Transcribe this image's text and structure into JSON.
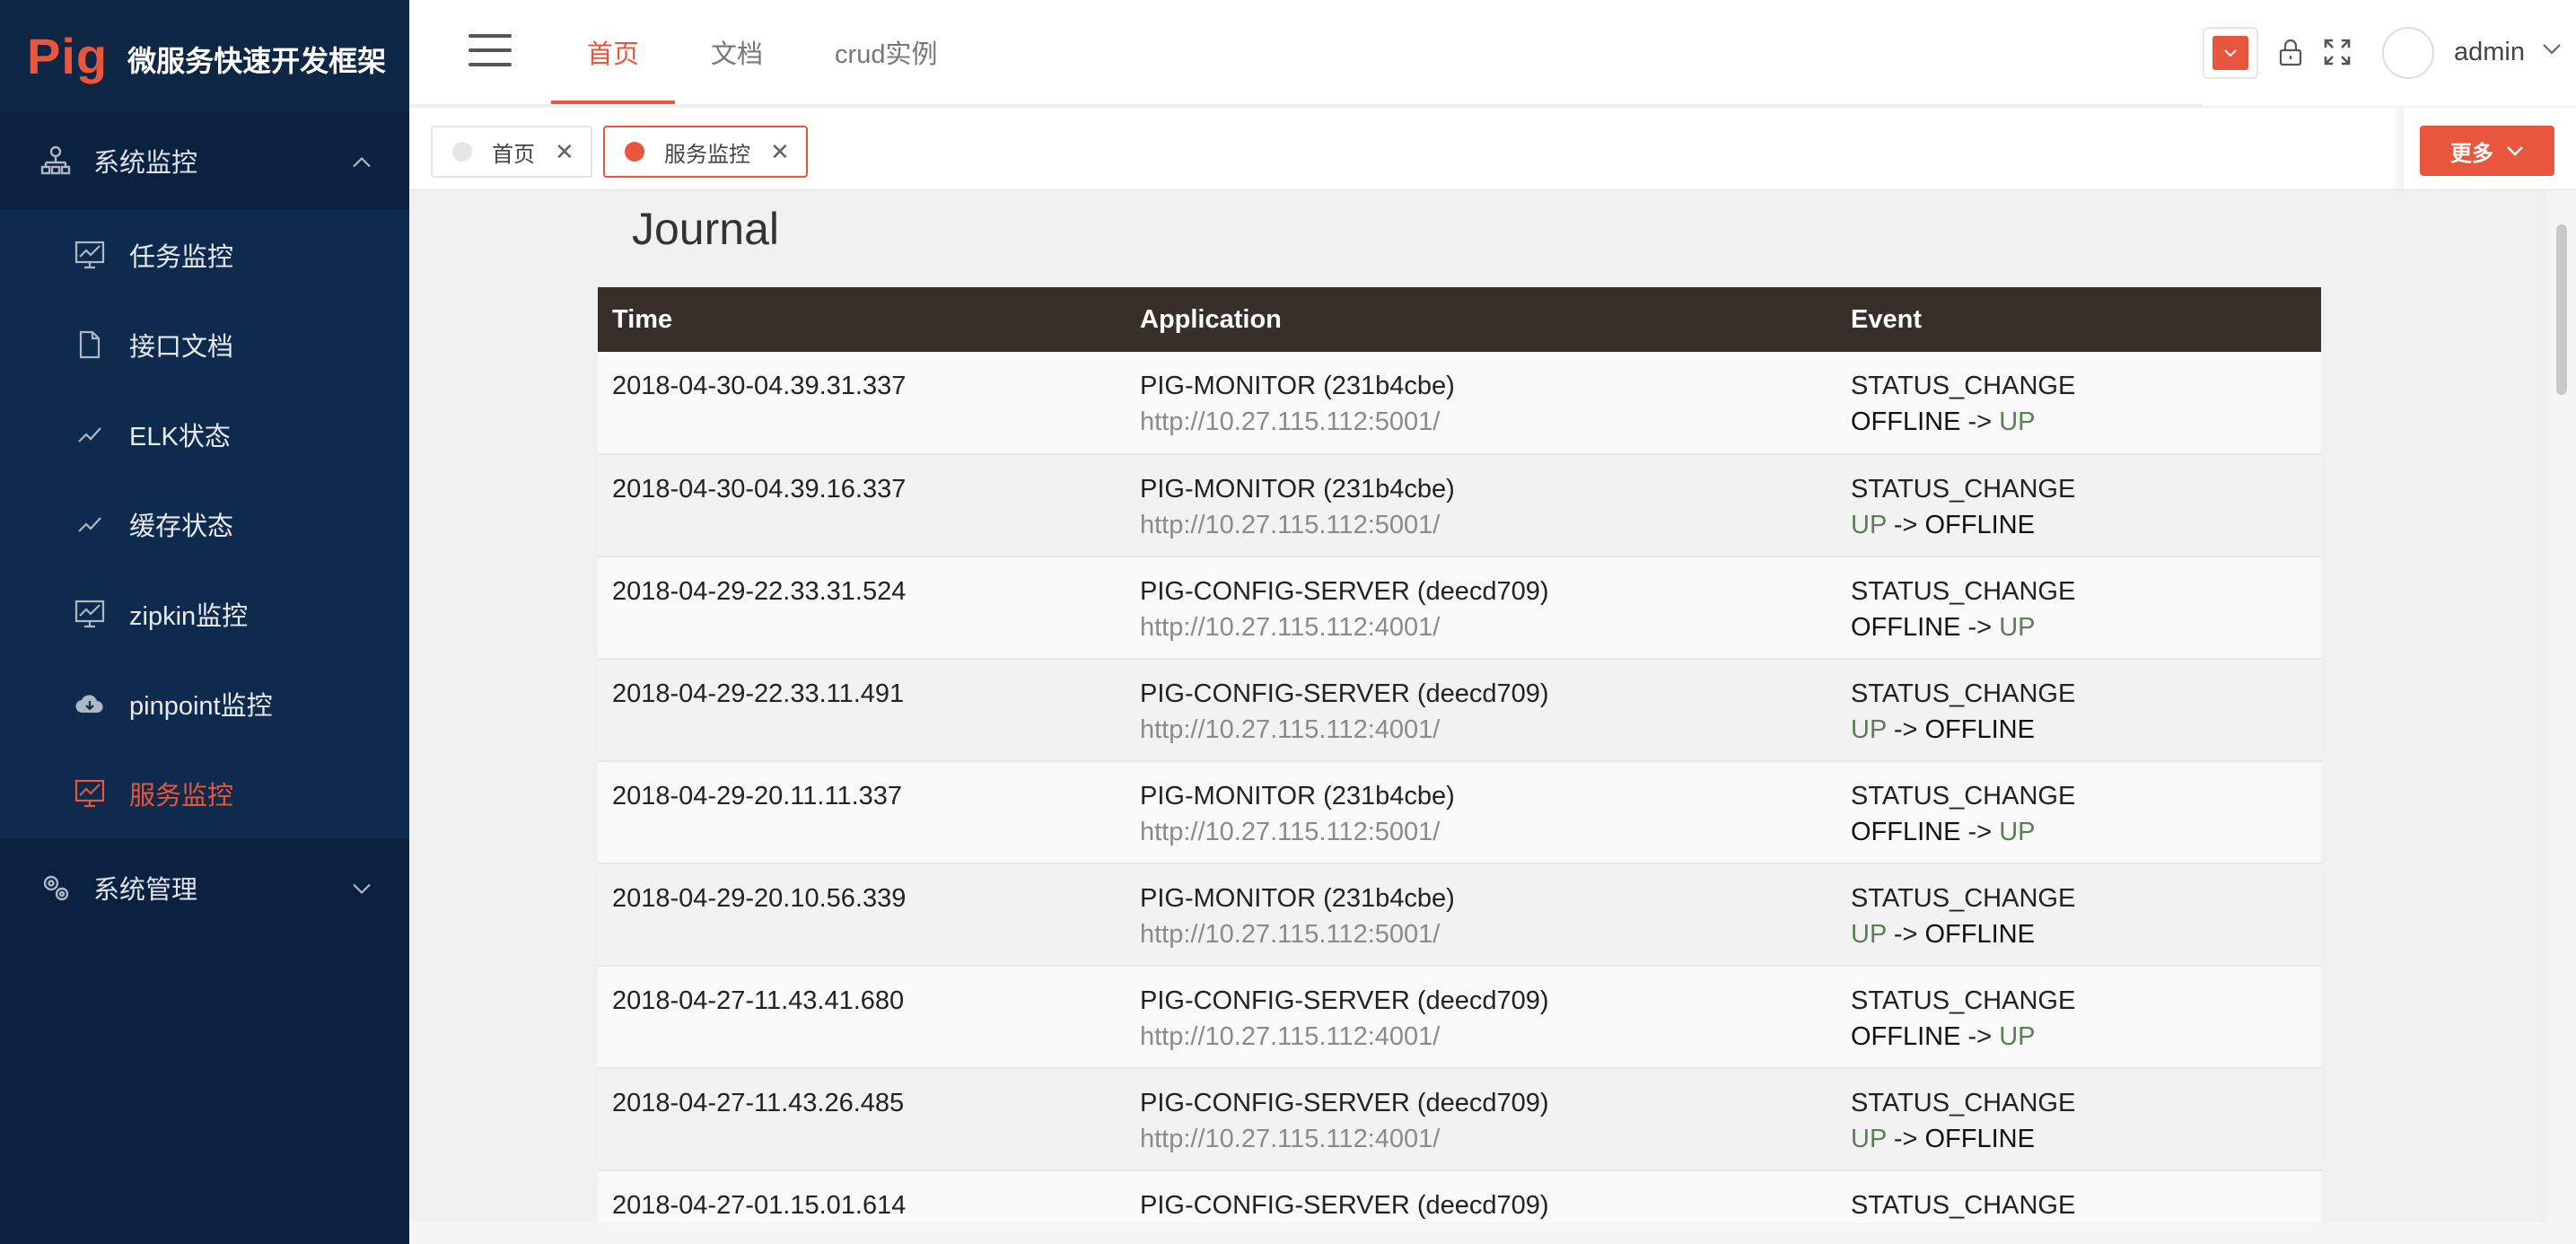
{
  "brand": {
    "mark": "Pig",
    "title": "微服务快速开发框架"
  },
  "sidebar": {
    "groups": [
      {
        "label": "系统监控",
        "expanded": true
      },
      {
        "label": "系统管理",
        "expanded": false
      }
    ],
    "items": [
      {
        "label": "任务监控",
        "icon": "monitor-chart-icon"
      },
      {
        "label": "接口文档",
        "icon": "document-icon"
      },
      {
        "label": "ELK状态",
        "icon": "trend-line-icon"
      },
      {
        "label": "缓存状态",
        "icon": "trend-line-icon"
      },
      {
        "label": "zipkin监控",
        "icon": "monitor-chart-icon"
      },
      {
        "label": "pinpoint监控",
        "icon": "cloud-icon"
      },
      {
        "label": "服务监控",
        "icon": "monitor-chart-icon",
        "active": true
      }
    ]
  },
  "header": {
    "nav": [
      {
        "label": "首页",
        "active": true
      },
      {
        "label": "文档"
      },
      {
        "label": "crud实例"
      }
    ],
    "theme_color": "#e8563e",
    "user": "admin"
  },
  "tabs": [
    {
      "label": "首页",
      "active": false
    },
    {
      "label": "服务监控",
      "active": true
    }
  ],
  "more_label": "更多",
  "journal": {
    "title": "Journal",
    "columns": [
      "Time",
      "Application",
      "Event"
    ],
    "rows": [
      {
        "time": "2018-04-30-04.39.31.337",
        "app": "PIG-MONITOR (231b4cbe)",
        "url": "http://10.27.115.112:5001/",
        "event": "STATUS_CHANGE",
        "from": "OFFLINE",
        "to": "UP"
      },
      {
        "time": "2018-04-30-04.39.16.337",
        "app": "PIG-MONITOR (231b4cbe)",
        "url": "http://10.27.115.112:5001/",
        "event": "STATUS_CHANGE",
        "from": "UP",
        "to": "OFFLINE"
      },
      {
        "time": "2018-04-29-22.33.31.524",
        "app": "PIG-CONFIG-SERVER (deecd709)",
        "url": "http://10.27.115.112:4001/",
        "event": "STATUS_CHANGE",
        "from": "OFFLINE",
        "to": "UP"
      },
      {
        "time": "2018-04-29-22.33.11.491",
        "app": "PIG-CONFIG-SERVER (deecd709)",
        "url": "http://10.27.115.112:4001/",
        "event": "STATUS_CHANGE",
        "from": "UP",
        "to": "OFFLINE"
      },
      {
        "time": "2018-04-29-20.11.11.337",
        "app": "PIG-MONITOR (231b4cbe)",
        "url": "http://10.27.115.112:5001/",
        "event": "STATUS_CHANGE",
        "from": "OFFLINE",
        "to": "UP"
      },
      {
        "time": "2018-04-29-20.10.56.339",
        "app": "PIG-MONITOR (231b4cbe)",
        "url": "http://10.27.115.112:5001/",
        "event": "STATUS_CHANGE",
        "from": "UP",
        "to": "OFFLINE"
      },
      {
        "time": "2018-04-27-11.43.41.680",
        "app": "PIG-CONFIG-SERVER (deecd709)",
        "url": "http://10.27.115.112:4001/",
        "event": "STATUS_CHANGE",
        "from": "OFFLINE",
        "to": "UP"
      },
      {
        "time": "2018-04-27-11.43.26.485",
        "app": "PIG-CONFIG-SERVER (deecd709)",
        "url": "http://10.27.115.112:4001/",
        "event": "STATUS_CHANGE",
        "from": "UP",
        "to": "OFFLINE"
      },
      {
        "time": "2018-04-27-01.15.01.614",
        "app": "PIG-CONFIG-SERVER (deecd709)",
        "url": "",
        "event": "STATUS_CHANGE",
        "from": "",
        "to": ""
      }
    ]
  }
}
